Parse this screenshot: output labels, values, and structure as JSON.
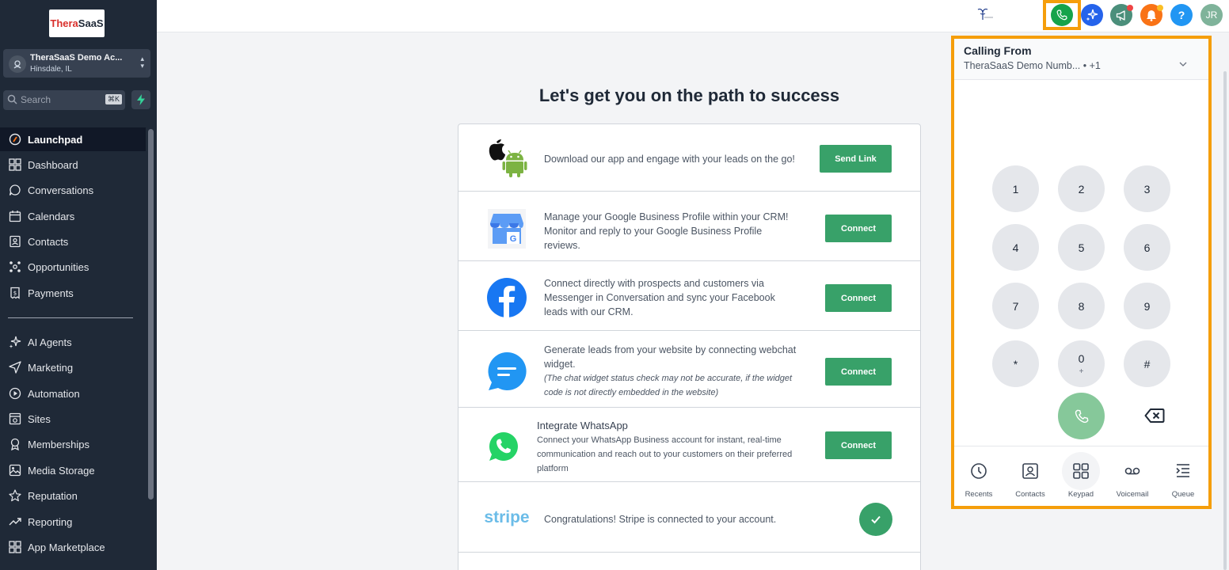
{
  "brand": {
    "logo_part1": "Thera",
    "logo_part2": "SaaS"
  },
  "account": {
    "name": "TheraSaaS Demo Ac...",
    "location": "Hinsdale, IL"
  },
  "search": {
    "placeholder": "Search",
    "shortcut": "⌘K"
  },
  "sidebar": {
    "items": [
      {
        "label": "Launchpad",
        "icon": "launchpad-icon"
      },
      {
        "label": "Dashboard",
        "icon": "dashboard-icon"
      },
      {
        "label": "Conversations",
        "icon": "chat-icon"
      },
      {
        "label": "Calendars",
        "icon": "calendar-icon"
      },
      {
        "label": "Contacts",
        "icon": "contacts-icon"
      },
      {
        "label": "Opportunities",
        "icon": "opportunities-icon"
      },
      {
        "label": "Payments",
        "icon": "payments-icon"
      },
      {
        "label": "AI Agents",
        "icon": "sparkle-icon"
      },
      {
        "label": "Marketing",
        "icon": "send-icon"
      },
      {
        "label": "Automation",
        "icon": "automation-icon"
      },
      {
        "label": "Sites",
        "icon": "sites-icon"
      },
      {
        "label": "Memberships",
        "icon": "memberships-icon"
      },
      {
        "label": "Media Storage",
        "icon": "image-icon"
      },
      {
        "label": "Reputation",
        "icon": "star-icon"
      },
      {
        "label": "Reporting",
        "icon": "trend-icon"
      },
      {
        "label": "App Marketplace",
        "icon": "grid-icon"
      }
    ]
  },
  "topbar": {
    "help_label": "?",
    "user_initials": "JR",
    "colors": {
      "phone": "#16a34a",
      "ai": "#2563eb",
      "announce": "#4b8f7b",
      "notify": "#f97316",
      "help": "#2196f3",
      "user": "#7fb39a"
    }
  },
  "main": {
    "title": "Let's get you on the path to success",
    "rows": [
      {
        "text": "Download our app and engage with your leads on the go!",
        "button": "Send Link"
      },
      {
        "text": "Manage your Google Business Profile within your CRM! Monitor and reply to your Google Business Profile reviews.",
        "button": "Connect"
      },
      {
        "text": "Connect directly with prospects and customers via Messenger in Conversation and sync your Facebook leads with our CRM.",
        "button": "Connect"
      },
      {
        "text": "Generate leads from your website by connecting webchat widget.",
        "note": "(The chat widget status check may not be accurate, if the widget code is not directly embedded in the website)",
        "button": "Connect"
      },
      {
        "title": "Integrate WhatsApp",
        "text": "Connect your WhatsApp Business account for instant, real-time communication and reach out to your customers on their preferred platform",
        "button": "Connect"
      },
      {
        "logo": "stripe",
        "text": "Congratulations! Stripe is connected to your account."
      }
    ]
  },
  "dialer": {
    "title": "Calling From",
    "from": "TheraSaaS Demo Numb... • +1",
    "keys": [
      {
        "digit": "1",
        "sub": ""
      },
      {
        "digit": "2",
        "sub": ""
      },
      {
        "digit": "3",
        "sub": ""
      },
      {
        "digit": "4",
        "sub": ""
      },
      {
        "digit": "5",
        "sub": ""
      },
      {
        "digit": "6",
        "sub": ""
      },
      {
        "digit": "7",
        "sub": ""
      },
      {
        "digit": "8",
        "sub": ""
      },
      {
        "digit": "9",
        "sub": ""
      },
      {
        "digit": "*",
        "sub": ""
      },
      {
        "digit": "0",
        "sub": "+"
      },
      {
        "digit": "#",
        "sub": ""
      }
    ],
    "tabs": [
      {
        "label": "Recents"
      },
      {
        "label": "Contacts"
      },
      {
        "label": "Keypad"
      },
      {
        "label": "Voicemail"
      },
      {
        "label": "Queue"
      }
    ]
  }
}
